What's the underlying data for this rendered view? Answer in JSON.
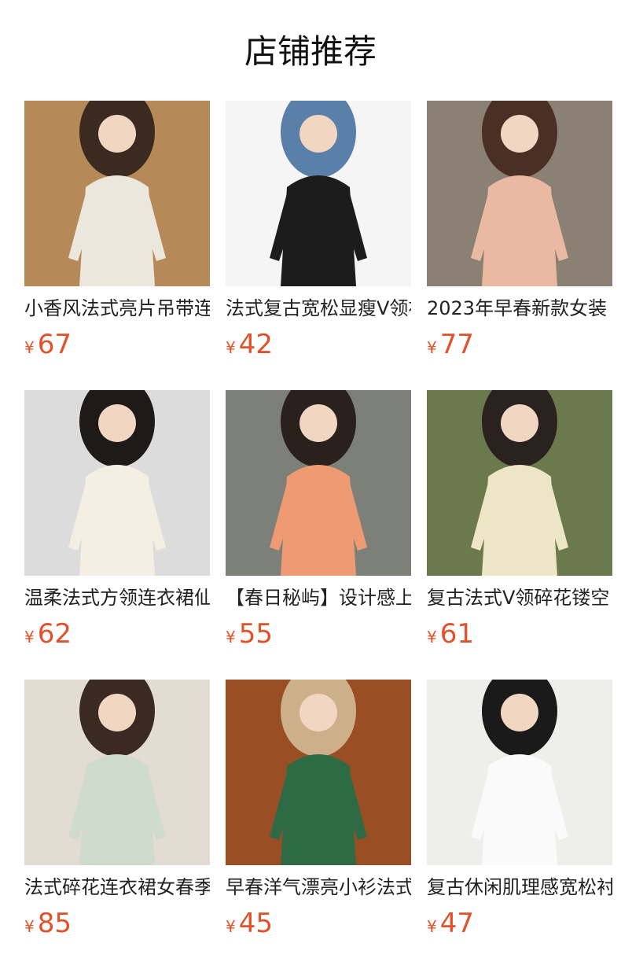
{
  "page": {
    "title": "店铺推荐"
  },
  "currency_symbol": "¥",
  "colors": {
    "price": "#e2522a",
    "title": "#111111"
  },
  "products": [
    {
      "name": "小香风法式亮片吊带连衣裙",
      "price": "67",
      "photo": [
        "#b58a58",
        "#ece7dc",
        "#3a2a20"
      ]
    },
    {
      "name": "法式复古宽松显瘦V领衬衫",
      "price": "42",
      "photo": [
        "#f5f5f5",
        "#1c1c1c",
        "#5a7fa8"
      ]
    },
    {
      "name": "2023年早春新款女装",
      "price": "77",
      "photo": [
        "#8a8074",
        "#e9b9a2",
        "#4a3024"
      ]
    },
    {
      "name": "温柔法式方领连衣裙仙女",
      "price": "62",
      "photo": [
        "#dcdcdc",
        "#f4efe2",
        "#1e1a18"
      ]
    },
    {
      "name": "【春日秘屿】设计感上衣",
      "price": "55",
      "photo": [
        "#7d8078",
        "#ee9a72",
        "#2a201c"
      ]
    },
    {
      "name": "复古法式V领碎花镂空",
      "price": "61",
      "photo": [
        "#6a7a4c",
        "#ece6c6",
        "#2a221e"
      ]
    },
    {
      "name": "法式碎花连衣裙女春季",
      "price": "85",
      "photo": [
        "#e2dcd2",
        "#cfdccd",
        "#3a2a22"
      ]
    },
    {
      "name": "早春洋气漂亮小衫法式",
      "price": "45",
      "photo": [
        "#9a4e24",
        "#2e6a44",
        "#cdb08a"
      ]
    },
    {
      "name": "复古休闲肌理感宽松衬衫",
      "price": "47",
      "photo": [
        "#eeeeea",
        "#fafafa",
        "#1a1a1a"
      ]
    }
  ]
}
